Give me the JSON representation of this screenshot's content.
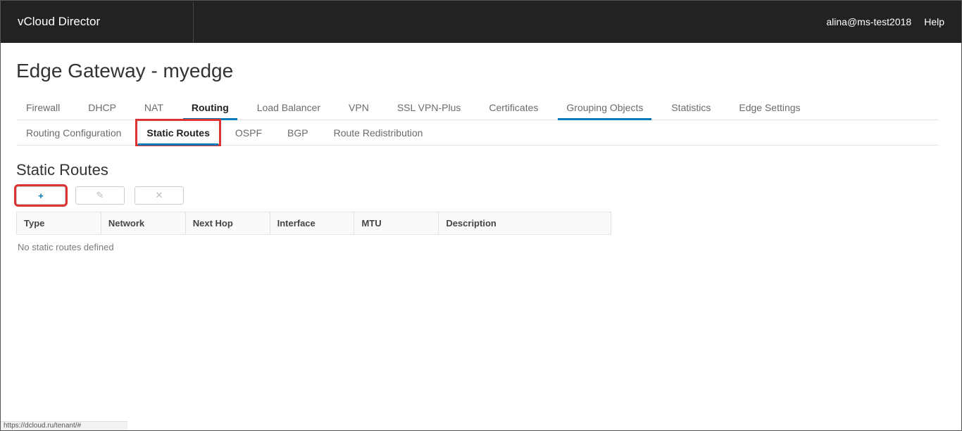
{
  "topbar": {
    "brand": "vCloud Director",
    "user": "alina@ms-test2018",
    "help": "Help"
  },
  "page_title": "Edge Gateway - myedge",
  "tabs": [
    {
      "label": "Firewall"
    },
    {
      "label": "DHCP"
    },
    {
      "label": "NAT"
    },
    {
      "label": "Routing"
    },
    {
      "label": "Load Balancer"
    },
    {
      "label": "VPN"
    },
    {
      "label": "SSL VPN-Plus"
    },
    {
      "label": "Certificates"
    },
    {
      "label": "Grouping Objects"
    },
    {
      "label": "Statistics"
    },
    {
      "label": "Edge Settings"
    }
  ],
  "subtabs": [
    {
      "label": "Routing Configuration"
    },
    {
      "label": "Static Routes"
    },
    {
      "label": "OSPF"
    },
    {
      "label": "BGP"
    },
    {
      "label": "Route Redistribution"
    }
  ],
  "section_title": "Static Routes",
  "toolbar": {
    "add": "+",
    "edit": "✎",
    "delete": "✕"
  },
  "columns": [
    "Type",
    "Network",
    "Next Hop",
    "Interface",
    "MTU",
    "Description"
  ],
  "empty_message": "No static routes defined",
  "status_url": "https://dcloud.ru/tenant/#"
}
